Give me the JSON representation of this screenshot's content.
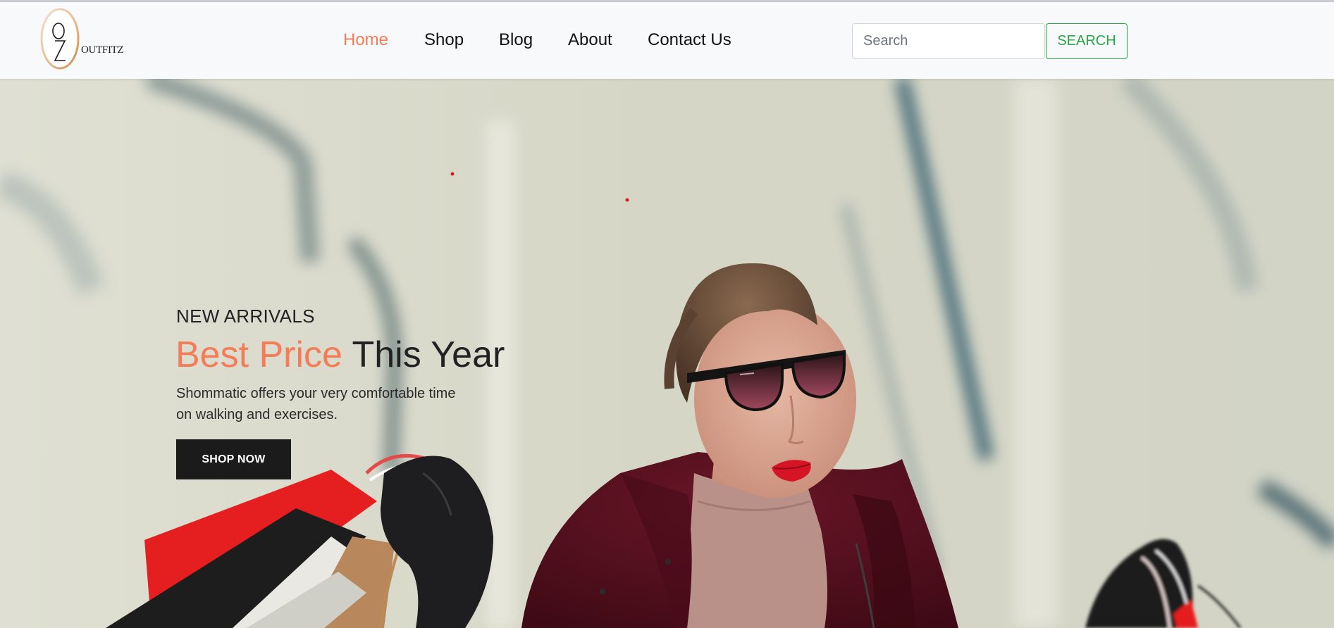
{
  "brand": {
    "logo_text": "OUTFITZ",
    "logo_initials": "OZ"
  },
  "nav": {
    "items": [
      {
        "label": "Home",
        "active": true
      },
      {
        "label": "Shop",
        "active": false
      },
      {
        "label": "Blog",
        "active": false
      },
      {
        "label": "About",
        "active": false
      },
      {
        "label": "Contact Us",
        "active": false
      }
    ]
  },
  "search": {
    "placeholder": "Search",
    "button_label": "SEARCH"
  },
  "hero": {
    "eyebrow": "NEW ARRIVALS",
    "headline_accent": "Best Price",
    "headline_rest": "This Year",
    "description_line1": "Shommatic offers your very comfortable time",
    "description_line2": "on walking and exercises.",
    "cta_label": "SHOP NOW",
    "image_subject": "woman-with-sunglasses-and-shopping-bags"
  },
  "colors": {
    "accent": "#f47c56",
    "search_green": "#28a745",
    "cta_dark": "#1b1b1b",
    "header_bg": "#f8f9fb"
  }
}
